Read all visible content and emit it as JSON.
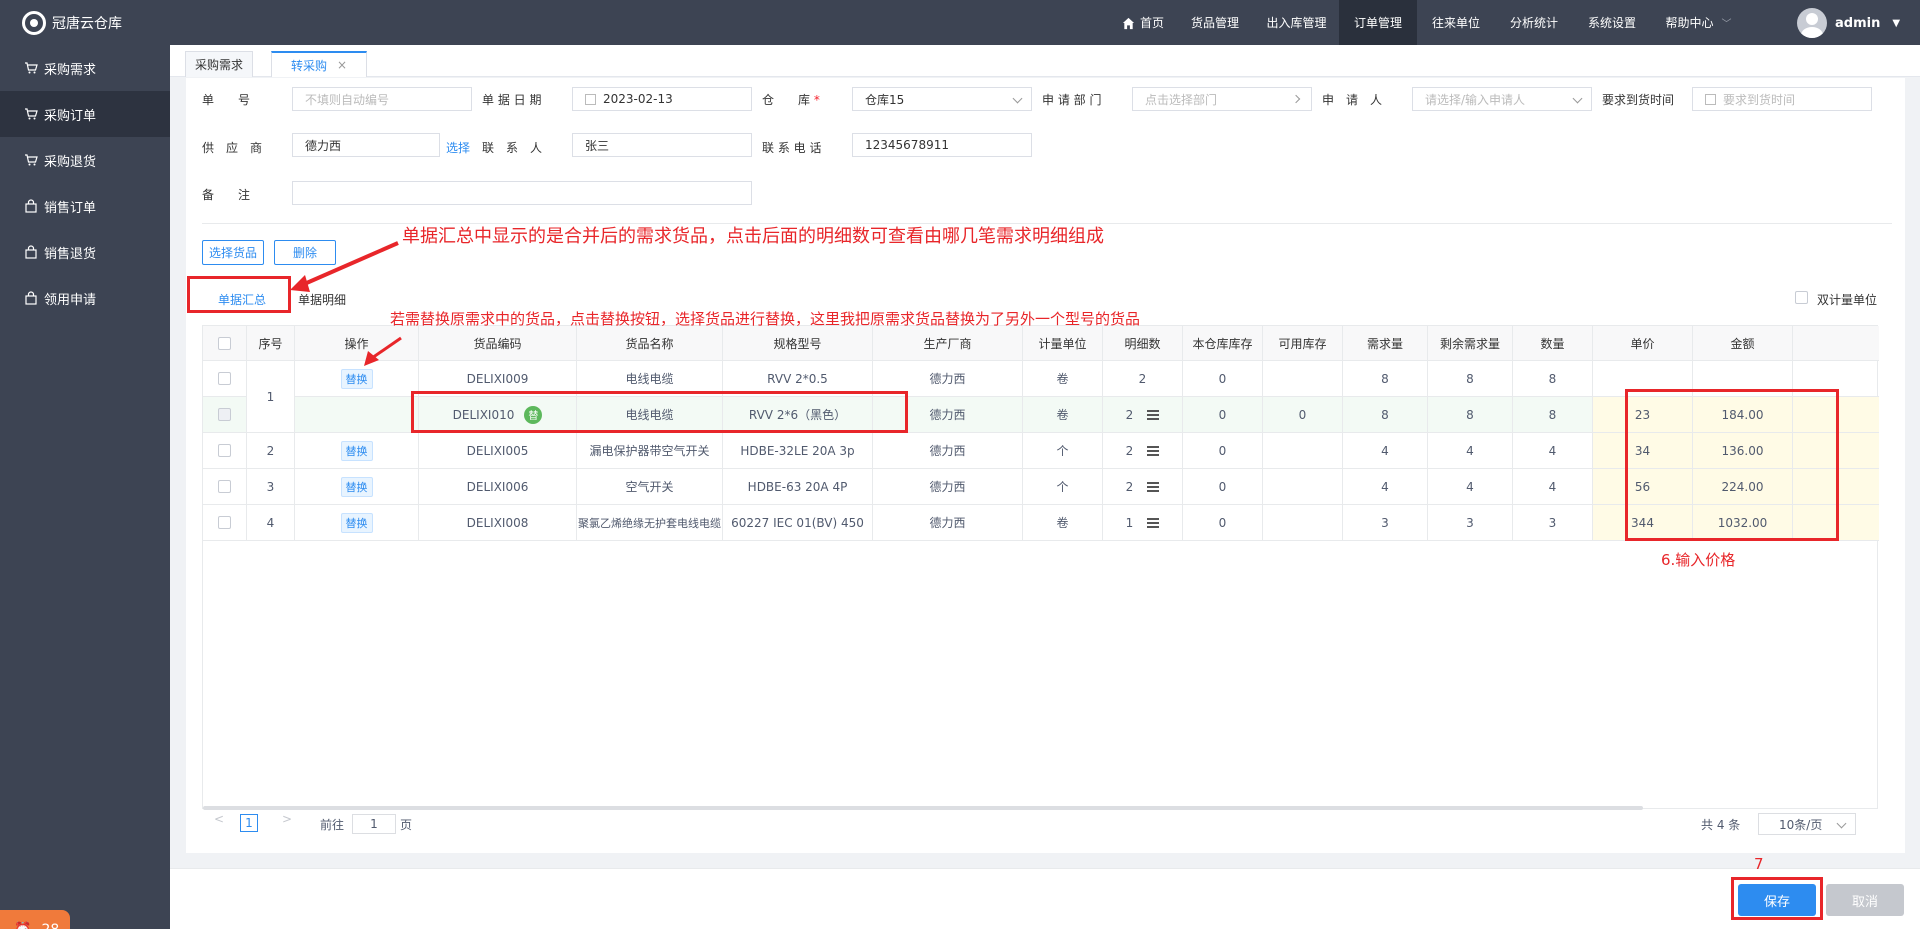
{
  "app": {
    "title": "冠唐云仓库"
  },
  "nav": {
    "items": [
      {
        "label": "首页"
      },
      {
        "label": "货品管理"
      },
      {
        "label": "出入库管理"
      },
      {
        "label": "订单管理"
      },
      {
        "label": "往来单位"
      },
      {
        "label": "分析统计"
      },
      {
        "label": "系统设置"
      },
      {
        "label": "帮助中心"
      }
    ],
    "active": "订单管理",
    "user": "admin"
  },
  "sidebar": {
    "items": [
      {
        "label": "采购需求"
      },
      {
        "label": "采购订单"
      },
      {
        "label": "采购退货"
      },
      {
        "label": "销售订单"
      },
      {
        "label": "销售退货"
      },
      {
        "label": "领用申请"
      }
    ],
    "active": "采购订单",
    "notification_count": "28"
  },
  "tabs": [
    {
      "label": "采购需求"
    },
    {
      "label": "转采购",
      "close": "×"
    }
  ],
  "form": {
    "order_no": {
      "label": "单　　号",
      "placeholder": "不填则自动编号"
    },
    "date": {
      "label": "单 据 日 期",
      "value": "2023-02-13"
    },
    "warehouse": {
      "label": "仓　　库",
      "required": "*",
      "value": "仓库15"
    },
    "dept": {
      "label": "申 请 部 门",
      "placeholder": "点击选择部门"
    },
    "applicant": {
      "label": "申　请　人",
      "placeholder": "请选择/输入申请人"
    },
    "due": {
      "label": "要求到货时间",
      "placeholder": "要求到货时间"
    },
    "supplier": {
      "label": "供　应　商",
      "value": "德力西",
      "select": "选择"
    },
    "contact": {
      "label": "联　系　人",
      "value": "张三"
    },
    "phone": {
      "label": "联 系 电 话",
      "value": "12345678911"
    },
    "remark": {
      "label": "备　　注",
      "value": ""
    }
  },
  "buttons": {
    "select_goods": "选择货品",
    "delete": "删除",
    "save": "保存",
    "cancel": "取消"
  },
  "subtabs": {
    "summary": "单据汇总",
    "detail": "单据明细",
    "dual_unit": "双计量单位"
  },
  "annotations": {
    "a1": "单据汇总中显示的是合并后的需求货品，点击后面的明细数可查看由哪几笔需求明细组成",
    "a2": "若需替换原需求中的货品，点击替换按钮，选择货品进行替换，这里我把原需求货品替换为了另外一个型号的货品",
    "a3": "6.输入价格",
    "a4": "7"
  },
  "table": {
    "headers": [
      "序号",
      "操作",
      "货品编码",
      "货品名称",
      "规格型号",
      "生产厂商",
      "计量单位",
      "明细数",
      "本仓库库存",
      "可用库存",
      "需求量",
      "剩余需求量",
      "数量",
      "单价",
      "金额"
    ],
    "replace_label": "替换",
    "replaced_badge": "替",
    "rows": [
      {
        "seq": "1",
        "op": "替换",
        "code": "DELIXI009",
        "name": "电线电缆",
        "spec": "RVV 2*0.5",
        "maker": "德力西",
        "unit": "卷",
        "detail": "2",
        "stock": "0",
        "avail": "",
        "demand": "8",
        "remain": "8",
        "qty": "8",
        "price": "",
        "amount": ""
      },
      {
        "seq": "",
        "op": "",
        "code": "DELIXI010",
        "name": "电线电缆",
        "spec": "RVV 2*6（黑色）",
        "maker": "德力西",
        "unit": "卷",
        "detail": "2",
        "stock": "0",
        "avail": "0",
        "demand": "8",
        "remain": "8",
        "qty": "8",
        "price": "23",
        "amount": "184.00"
      },
      {
        "seq": "2",
        "op": "替换",
        "code": "DELIXI005",
        "name": "漏电保护器带空气开关",
        "spec": "HDBE-32LE 20A 3p",
        "maker": "德力西",
        "unit": "个",
        "detail": "2",
        "stock": "0",
        "avail": "",
        "demand": "4",
        "remain": "4",
        "qty": "4",
        "price": "34",
        "amount": "136.00"
      },
      {
        "seq": "3",
        "op": "替换",
        "code": "DELIXI006",
        "name": "空气开关",
        "spec": "HDBE-63 20A 4P",
        "maker": "德力西",
        "unit": "个",
        "detail": "2",
        "stock": "0",
        "avail": "",
        "demand": "4",
        "remain": "4",
        "qty": "4",
        "price": "56",
        "amount": "224.00"
      },
      {
        "seq": "4",
        "op": "替换",
        "code": "DELIXI008",
        "name": "聚氯乙烯绝缘无护套电线电缆",
        "spec": "60227 IEC 01(BV) 450",
        "maker": "德力西",
        "unit": "卷",
        "detail": "1",
        "stock": "0",
        "avail": "",
        "demand": "3",
        "remain": "3",
        "qty": "3",
        "price": "344",
        "amount": "1032.00"
      }
    ]
  },
  "pager": {
    "page": "1",
    "goto_label": "前往",
    "goto_value": "1",
    "page_suffix": "页",
    "total": "共 4 条",
    "size": "10条/页"
  }
}
